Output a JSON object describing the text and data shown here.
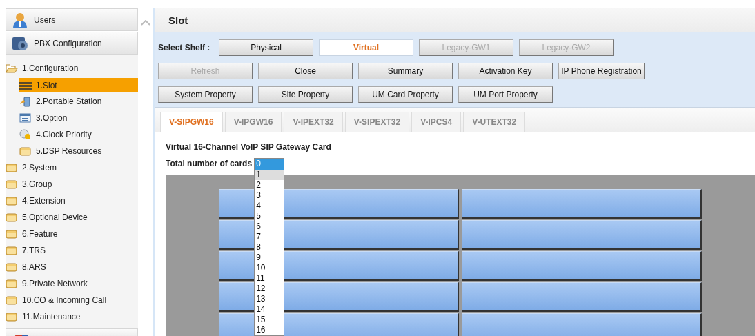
{
  "sidebar": {
    "panels": [
      {
        "label": "Users",
        "kind": "user"
      },
      {
        "label": "PBX Configuration",
        "kind": "pbx"
      }
    ],
    "tree": [
      {
        "label": "1.Configuration",
        "kind": "folder",
        "expanded": true,
        "selected": false,
        "children": [
          {
            "label": "1.Slot",
            "kind": "slot",
            "selected": true
          },
          {
            "label": "2.Portable Station",
            "kind": "station",
            "selected": false
          },
          {
            "label": "3.Option",
            "kind": "option",
            "selected": false
          },
          {
            "label": "4.Clock Priority",
            "kind": "clock",
            "selected": false
          },
          {
            "label": "5.DSP Resources",
            "kind": "folder",
            "expanded": false,
            "selected": false
          }
        ]
      },
      {
        "label": "2.System",
        "kind": "folder",
        "expanded": false,
        "selected": false
      },
      {
        "label": "3.Group",
        "kind": "folder",
        "expanded": false,
        "selected": false
      },
      {
        "label": "4.Extension",
        "kind": "folder",
        "expanded": false,
        "selected": false
      },
      {
        "label": "5.Optional Device",
        "kind": "folder",
        "expanded": false,
        "selected": false
      },
      {
        "label": "6.Feature",
        "kind": "folder",
        "expanded": false,
        "selected": false
      },
      {
        "label": "7.TRS",
        "kind": "folder",
        "expanded": false,
        "selected": false
      },
      {
        "label": "8.ARS",
        "kind": "folder",
        "expanded": false,
        "selected": false
      },
      {
        "label": "9.Private Network",
        "kind": "folder",
        "expanded": false,
        "selected": false
      },
      {
        "label": "10.CO & Incoming Call",
        "kind": "folder",
        "expanded": false,
        "selected": false
      },
      {
        "label": "11.Maintenance",
        "kind": "folder",
        "expanded": false,
        "selected": false
      }
    ]
  },
  "page": {
    "title": "Slot",
    "shelf": {
      "label": "Select Shelf :",
      "buttons": [
        {
          "label": "Physical",
          "selected": false,
          "disabled": false
        },
        {
          "label": "Virtual",
          "selected": true,
          "disabled": false
        },
        {
          "label": "Legacy-GW1",
          "selected": false,
          "disabled": true
        },
        {
          "label": "Legacy-GW2",
          "selected": false,
          "disabled": true
        }
      ]
    },
    "button_rows": [
      [
        {
          "label": "Refresh",
          "disabled": true
        },
        {
          "label": "Close",
          "disabled": false
        },
        {
          "label": "Summary",
          "disabled": false
        },
        {
          "label": "Activation Key",
          "disabled": false
        },
        {
          "label": "IP Phone Registration",
          "disabled": false
        }
      ],
      [
        {
          "label": "System Property",
          "disabled": false
        },
        {
          "label": "Site Property",
          "disabled": false
        },
        {
          "label": "UM Card Property",
          "disabled": false
        },
        {
          "label": "UM Port Property",
          "disabled": false
        }
      ]
    ],
    "tabs": [
      {
        "label": "V-SIPGW16",
        "selected": true
      },
      {
        "label": "V-IPGW16",
        "selected": false
      },
      {
        "label": "V-IPEXT32",
        "selected": false
      },
      {
        "label": "V-SIPEXT32",
        "selected": false
      },
      {
        "label": "V-IPCS4",
        "selected": false
      },
      {
        "label": "V-UTEXT32",
        "selected": false
      }
    ],
    "card_title": "Virtual 16-Channel VoIP SIP Gateway Card",
    "count_label": "Total number of cards",
    "count_options": [
      {
        "label": "0",
        "selected": true,
        "hovered": false
      },
      {
        "label": "1",
        "selected": false,
        "hovered": true
      },
      {
        "label": "2",
        "selected": false,
        "hovered": false
      },
      {
        "label": "3",
        "selected": false,
        "hovered": false
      },
      {
        "label": "4",
        "selected": false,
        "hovered": false
      },
      {
        "label": "5",
        "selected": false,
        "hovered": false
      },
      {
        "label": "6",
        "selected": false,
        "hovered": false
      },
      {
        "label": "7",
        "selected": false,
        "hovered": false
      },
      {
        "label": "8",
        "selected": false,
        "hovered": false
      },
      {
        "label": "9",
        "selected": false,
        "hovered": false
      },
      {
        "label": "10",
        "selected": false,
        "hovered": false
      },
      {
        "label": "11",
        "selected": false,
        "hovered": false
      },
      {
        "label": "12",
        "selected": false,
        "hovered": false
      },
      {
        "label": "13",
        "selected": false,
        "hovered": false
      },
      {
        "label": "14",
        "selected": false,
        "hovered": false
      },
      {
        "label": "15",
        "selected": false,
        "hovered": false
      },
      {
        "label": "16",
        "selected": false,
        "hovered": false
      }
    ],
    "slots": [
      {
        "kind": "empty"
      },
      {
        "kind": "empty"
      },
      {
        "kind": "empty"
      },
      {
        "kind": "empty"
      },
      {
        "kind": "empty"
      },
      {
        "kind": "empty"
      },
      {
        "kind": "empty"
      },
      {
        "kind": "empty"
      },
      {
        "kind": "empty"
      },
      {
        "kind": "empty"
      }
    ]
  }
}
